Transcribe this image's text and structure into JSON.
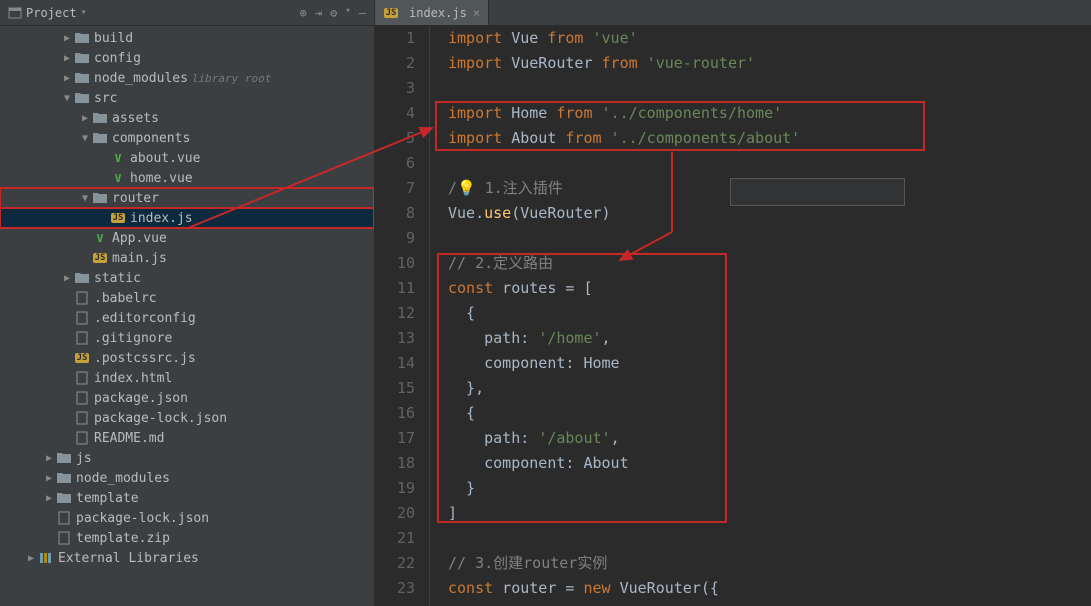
{
  "sidebar": {
    "title": "Project",
    "toolbar_icons": [
      "target-icon",
      "expand-icon",
      "gear-icon",
      "collapse-icon"
    ],
    "tree": [
      {
        "depth": 1,
        "arrow": "▶",
        "icon": "folder",
        "label": "build"
      },
      {
        "depth": 1,
        "arrow": "▶",
        "icon": "folder",
        "label": "config"
      },
      {
        "depth": 1,
        "arrow": "▶",
        "icon": "folder",
        "label": "node_modules",
        "suffix": "library root"
      },
      {
        "depth": 1,
        "arrow": "▼",
        "icon": "folder",
        "label": "src"
      },
      {
        "depth": 2,
        "arrow": "▶",
        "icon": "folder",
        "label": "assets"
      },
      {
        "depth": 2,
        "arrow": "▼",
        "icon": "folder",
        "label": "components"
      },
      {
        "depth": 3,
        "arrow": "",
        "icon": "vue",
        "label": "about.vue"
      },
      {
        "depth": 3,
        "arrow": "",
        "icon": "vue",
        "label": "home.vue"
      },
      {
        "depth": 2,
        "arrow": "▼",
        "icon": "folder",
        "label": "router",
        "boxed": true
      },
      {
        "depth": 3,
        "arrow": "",
        "icon": "js",
        "label": "index.js",
        "selected": true,
        "boxed": true
      },
      {
        "depth": 2,
        "arrow": "",
        "icon": "vue",
        "label": "App.vue"
      },
      {
        "depth": 2,
        "arrow": "",
        "icon": "js",
        "label": "main.js"
      },
      {
        "depth": 1,
        "arrow": "▶",
        "icon": "folder",
        "label": "static"
      },
      {
        "depth": 1,
        "arrow": "",
        "icon": "file",
        "label": ".babelrc"
      },
      {
        "depth": 1,
        "arrow": "",
        "icon": "file",
        "label": ".editorconfig"
      },
      {
        "depth": 1,
        "arrow": "",
        "icon": "file",
        "label": ".gitignore"
      },
      {
        "depth": 1,
        "arrow": "",
        "icon": "js",
        "label": ".postcssrc.js"
      },
      {
        "depth": 1,
        "arrow": "",
        "icon": "file",
        "label": "index.html"
      },
      {
        "depth": 1,
        "arrow": "",
        "icon": "file",
        "label": "package.json"
      },
      {
        "depth": 1,
        "arrow": "",
        "icon": "file",
        "label": "package-lock.json"
      },
      {
        "depth": 1,
        "arrow": "",
        "icon": "file",
        "label": "README.md"
      },
      {
        "depth": 0,
        "arrow": "▶",
        "icon": "folder",
        "label": "js"
      },
      {
        "depth": 0,
        "arrow": "▶",
        "icon": "folder",
        "label": "node_modules"
      },
      {
        "depth": 0,
        "arrow": "▶",
        "icon": "folder",
        "label": "template"
      },
      {
        "depth": 0,
        "arrow": "",
        "icon": "file",
        "label": "package-lock.json"
      },
      {
        "depth": 0,
        "arrow": "",
        "icon": "file",
        "label": "template.zip"
      },
      {
        "depth": -1,
        "arrow": "▶",
        "icon": "lib",
        "label": "External Libraries"
      }
    ]
  },
  "tab": {
    "icon": "js",
    "label": "index.js"
  },
  "code": {
    "lines": [
      {
        "n": 1,
        "tokens": [
          [
            "kw",
            "import"
          ],
          [
            "id",
            " Vue "
          ],
          [
            "kw",
            "from"
          ],
          [
            "str",
            " 'vue'"
          ]
        ]
      },
      {
        "n": 2,
        "tokens": [
          [
            "kw",
            "import"
          ],
          [
            "id",
            " VueRouter "
          ],
          [
            "kw",
            "from"
          ],
          [
            "str",
            " 'vue-router'"
          ]
        ]
      },
      {
        "n": 3,
        "tokens": [
          [
            "",
            "  "
          ]
        ]
      },
      {
        "n": 4,
        "tokens": [
          [
            "kw",
            "import"
          ],
          [
            "id",
            " Home "
          ],
          [
            "kw",
            "from"
          ],
          [
            "str",
            " '../components/home'"
          ]
        ]
      },
      {
        "n": 5,
        "tokens": [
          [
            "kw",
            "import"
          ],
          [
            "id",
            " About "
          ],
          [
            "kw",
            "from"
          ],
          [
            "str",
            " '../components/about'"
          ]
        ]
      },
      {
        "n": 6,
        "tokens": [
          [
            "",
            "  "
          ]
        ]
      },
      {
        "n": 7,
        "tokens": [
          [
            "cmt",
            "/"
          ],
          [
            "bulb",
            "💡"
          ],
          [
            "cmt",
            " 1.注入插件"
          ]
        ]
      },
      {
        "n": 8,
        "tokens": [
          [
            "id",
            "Vue."
          ],
          [
            "fn",
            "use"
          ],
          [
            "pun",
            "("
          ],
          [
            "id",
            "VueRouter"
          ],
          [
            "pun",
            ")"
          ]
        ]
      },
      {
        "n": 9,
        "tokens": [
          [
            "",
            "  "
          ]
        ]
      },
      {
        "n": 10,
        "tokens": [
          [
            "cmt",
            "// 2.定义路由"
          ]
        ]
      },
      {
        "n": 11,
        "tokens": [
          [
            "kw",
            "const"
          ],
          [
            "id",
            " routes "
          ],
          [
            "pun",
            "= ["
          ]
        ]
      },
      {
        "n": 12,
        "tokens": [
          [
            "pun",
            "  {"
          ]
        ]
      },
      {
        "n": 13,
        "tokens": [
          [
            "id",
            "    path"
          ],
          [
            "pun",
            ": "
          ],
          [
            "str",
            "'/home'"
          ],
          [
            "pun",
            ","
          ]
        ]
      },
      {
        "n": 14,
        "tokens": [
          [
            "id",
            "    component"
          ],
          [
            "pun",
            ": "
          ],
          [
            "id",
            "Home"
          ]
        ]
      },
      {
        "n": 15,
        "tokens": [
          [
            "pun",
            "  },"
          ]
        ]
      },
      {
        "n": 16,
        "tokens": [
          [
            "pun",
            "  {"
          ]
        ]
      },
      {
        "n": 17,
        "tokens": [
          [
            "id",
            "    path"
          ],
          [
            "pun",
            ": "
          ],
          [
            "str",
            "'/about'"
          ],
          [
            "pun",
            ","
          ]
        ]
      },
      {
        "n": 18,
        "tokens": [
          [
            "id",
            "    component"
          ],
          [
            "pun",
            ": "
          ],
          [
            "id",
            "About"
          ]
        ]
      },
      {
        "n": 19,
        "tokens": [
          [
            "pun",
            "  }"
          ]
        ]
      },
      {
        "n": 20,
        "tokens": [
          [
            "pun",
            "]"
          ]
        ]
      },
      {
        "n": 21,
        "tokens": [
          [
            "",
            "  "
          ]
        ]
      },
      {
        "n": 22,
        "tokens": [
          [
            "cmt",
            "// 3.创建router实例"
          ]
        ]
      },
      {
        "n": 23,
        "tokens": [
          [
            "kw",
            "const"
          ],
          [
            "id",
            " router "
          ],
          [
            "pun",
            "= "
          ],
          [
            "kw",
            "new"
          ],
          [
            "id",
            " VueRouter"
          ],
          [
            "pun",
            "({"
          ]
        ]
      }
    ]
  }
}
